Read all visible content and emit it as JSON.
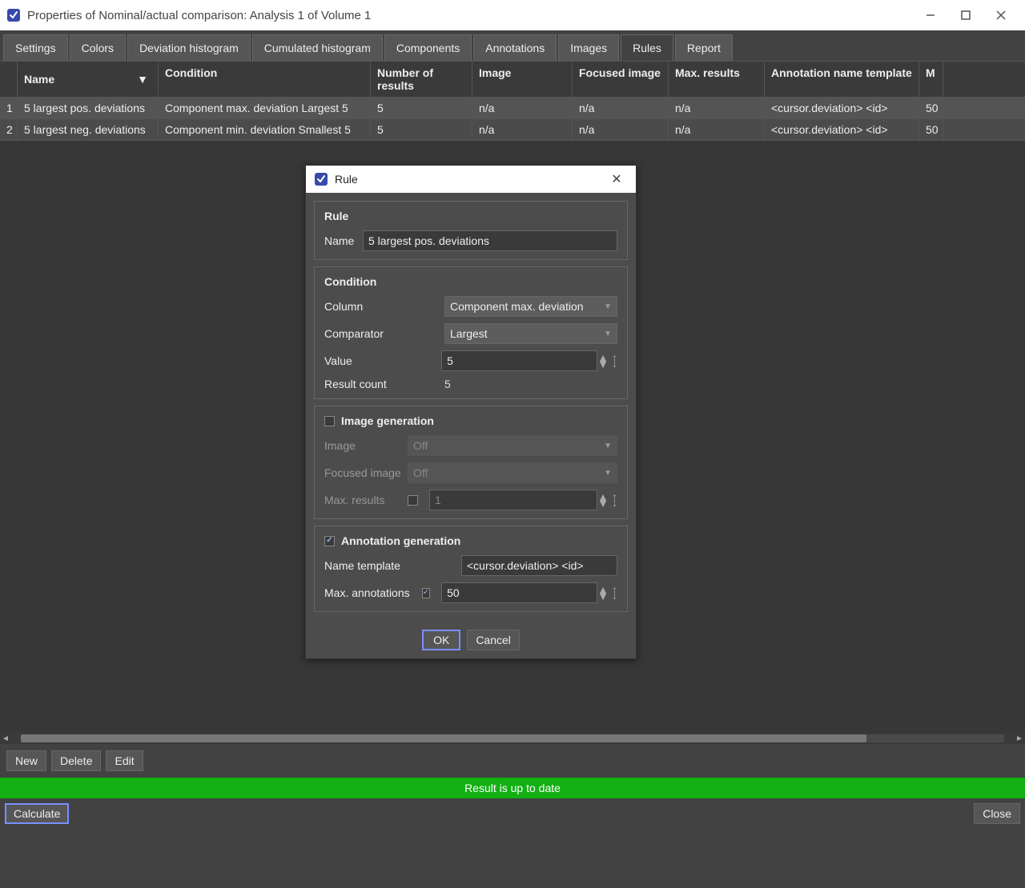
{
  "window": {
    "title": "Properties of Nominal/actual comparison: Analysis 1 of Volume 1"
  },
  "tabs": [
    "Settings",
    "Colors",
    "Deviation histogram",
    "Cumulated histogram",
    "Components",
    "Annotations",
    "Images",
    "Rules",
    "Report"
  ],
  "active_tab": "Rules",
  "table": {
    "headers": {
      "name": "Name",
      "cond": "Condition",
      "nres": "Number of results",
      "img": "Image",
      "fimg": "Focused image",
      "max": "Max. results",
      "tmpl": "Annotation name template",
      "m": "M"
    },
    "rows": [
      {
        "idx": "1",
        "name": "5 largest pos. deviations",
        "cond": "Component max. deviation Largest 5",
        "nres": "5",
        "img": "n/a",
        "fimg": "n/a",
        "max": "n/a",
        "tmpl": "<cursor.deviation> <id>",
        "m": "50"
      },
      {
        "idx": "2",
        "name": "5 largest neg. deviations",
        "cond": "Component min. deviation Smallest 5",
        "nres": "5",
        "img": "n/a",
        "fimg": "n/a",
        "max": "n/a",
        "tmpl": "<cursor.deviation> <id>",
        "m": "50"
      }
    ]
  },
  "toolbar": {
    "new": "New",
    "delete": "Delete",
    "edit": "Edit"
  },
  "status": "Result is up to date",
  "footer": {
    "calc": "Calculate",
    "close": "Close"
  },
  "dialog": {
    "title": "Rule",
    "rule": {
      "section": "Rule",
      "name_label": "Name",
      "name_value": "5 largest pos. deviations"
    },
    "condition": {
      "section": "Condition",
      "column_label": "Column",
      "column_value": "Component max. deviation",
      "comparator_label": "Comparator",
      "comparator_value": "Largest",
      "value_label": "Value",
      "value_value": "5",
      "resultcount_label": "Result count",
      "resultcount_value": "5"
    },
    "imagegen": {
      "section": "Image generation",
      "checked": false,
      "image_label": "Image",
      "image_value": "Off",
      "fimage_label": "Focused image",
      "fimage_value": "Off",
      "max_label": "Max. results",
      "max_checked": false,
      "max_value": "1"
    },
    "anngen": {
      "section": "Annotation generation",
      "checked": true,
      "tmpl_label": "Name template",
      "tmpl_value": "<cursor.deviation> <id>",
      "max_label": "Max. annotations",
      "max_checked": true,
      "max_value": "50"
    },
    "buttons": {
      "ok": "OK",
      "cancel": "Cancel"
    }
  }
}
